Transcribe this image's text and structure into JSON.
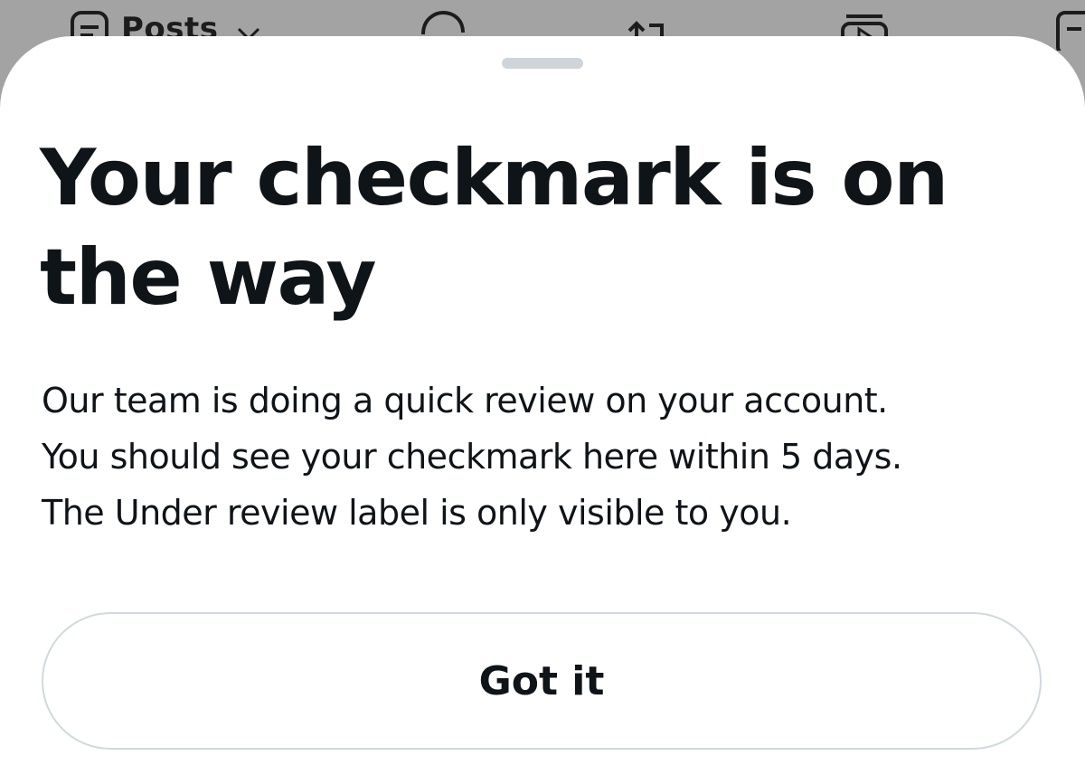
{
  "background_toolbar": {
    "posts_label": "Posts",
    "icons": [
      "posts-list-icon",
      "chevron-down-icon",
      "comment-icon",
      "share-icon",
      "media-icon",
      "compose-icon"
    ]
  },
  "sheet": {
    "title": "Your checkmark is on the way",
    "body_lines": [
      "Our team is doing a quick review on your account.",
      "You should see your checkmark here within 5 days.",
      "The Under review label is only visible to you."
    ],
    "button_label": "Got it"
  },
  "colors": {
    "text": "#0f1419",
    "sheet_background": "#ffffff",
    "overlay": "#a3a3a3",
    "button_border": "#cfd9de",
    "grabber": "#cfd4d8"
  }
}
